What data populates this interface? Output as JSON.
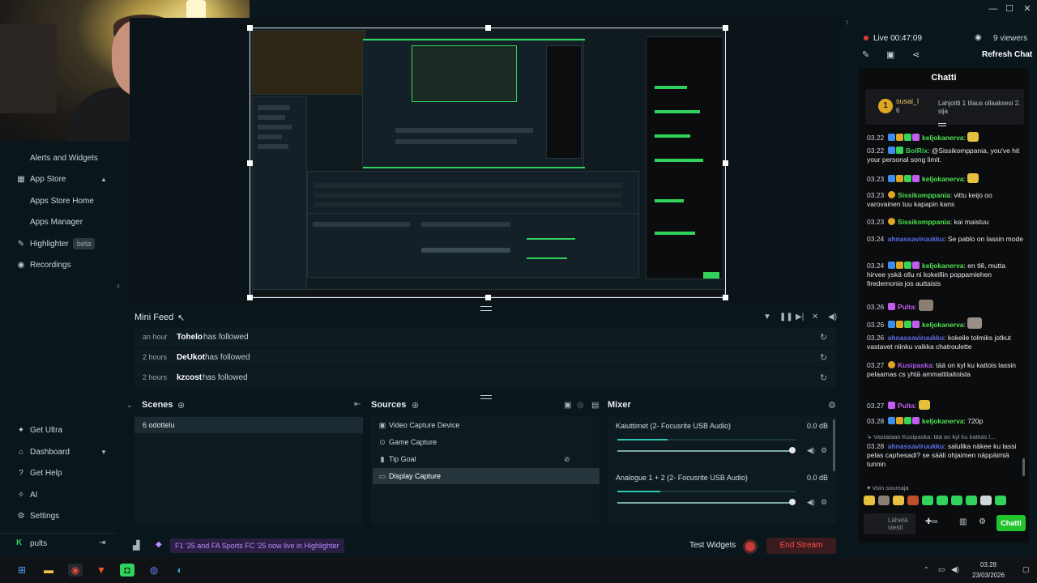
{
  "sidebar": {
    "items": [
      {
        "label": "Alerts and Widgets",
        "icon": "none"
      },
      {
        "label": "App Store",
        "icon": "store-icon"
      },
      {
        "label": "Apps Store Home",
        "icon": "none"
      },
      {
        "label": "Apps Manager",
        "icon": "none"
      },
      {
        "label": "Highlighter",
        "icon": "highlighter-icon",
        "badge": "beta"
      },
      {
        "label": "Recordings",
        "icon": "recordings-icon"
      }
    ],
    "bottom_items": [
      {
        "label": "Get Ultra",
        "icon": "ultra-icon"
      },
      {
        "label": "Dashboard",
        "icon": "dashboard-icon"
      },
      {
        "label": "Get Help",
        "icon": "help-icon"
      },
      {
        "label": "AI",
        "icon": "ai-icon"
      },
      {
        "label": "Settings",
        "icon": "gear-icon"
      }
    ],
    "user": "pults"
  },
  "minifeed": {
    "title": "Mini Feed",
    "rows": [
      {
        "time": "an hour",
        "user": "Tohelo",
        "action": "has followed"
      },
      {
        "time": "2 hours",
        "user": "DeUkot",
        "action": "has followed"
      },
      {
        "time": "2 hours",
        "user": "kzcost",
        "action": "has followed"
      }
    ]
  },
  "scenes": {
    "title": "Scenes",
    "items": [
      "6 odottelu"
    ]
  },
  "sources": {
    "title": "Sources",
    "items": [
      {
        "label": "Video Capture Device",
        "icon": "camera-icon"
      },
      {
        "label": "Game Capture",
        "icon": "gamepad-icon"
      },
      {
        "label": "Tip Goal",
        "icon": "file-icon"
      },
      {
        "label": "Display Capture",
        "icon": "monitor-icon"
      }
    ],
    "selected_index": 3
  },
  "mixer": {
    "title": "Mixer",
    "channels": [
      {
        "name": "Kaiuttimet (2- Focusrite USB Audio)",
        "db": "0.0 dB",
        "level": 0.28,
        "volume": 1.0
      },
      {
        "name": "Analogue 1 + 2 (2- Focusrite USB Audio)",
        "db": "0.0 dB",
        "level": 0.24,
        "volume": 1.0
      }
    ]
  },
  "footer": {
    "promo": "F1 '25 and FA Sports FC '25 now live in Highlighter",
    "test_widgets": "Test Widgets",
    "end_stream": "End Stream"
  },
  "chat": {
    "live": "Live 00:47:09",
    "viewers": "9 viewers",
    "refresh": "Refresh Chat",
    "title": "Chatti",
    "pinned": {
      "name": "susai_l",
      "count": "6",
      "text": "Lahjoitti 1 tilaus ollaaksesi 2. sija"
    },
    "messages": [
      {
        "time": "03.22",
        "name": "keljokanerva",
        "color": "#4fe24f",
        "text": ""
      },
      {
        "time": "03.22",
        "name": "BolRix",
        "color": "#3ad35a",
        "text": "@Sissikomppania, you've hit your personal song limit."
      },
      {
        "time": "03.23",
        "name": "keljokanerva",
        "color": "#4fe24f",
        "text": ""
      },
      {
        "time": "03.23",
        "name": "Sissikomppania",
        "color": "#4fe24f",
        "text": "vittu keijo oo varovainen tuu kapapin kans"
      },
      {
        "time": "03.23",
        "name": "Sissikomppania",
        "color": "#4fe24f",
        "text": "kai maistuu"
      },
      {
        "time": "03.24",
        "name": "ahnassaviruukku",
        "color": "#5b6ee8",
        "text": "Se pablo on lassin mode"
      },
      {
        "time": "03.24",
        "name": "keljokanerva",
        "color": "#4fe24f",
        "text": "en tlê, mutta hirvee yskä ollu ni kokeillin poppamiehen firedemonia jos auttaisis"
      },
      {
        "time": "03.26",
        "name": "Pulta",
        "color": "#c45cf0",
        "text": ""
      },
      {
        "time": "03.26",
        "name": "keljokanerva",
        "color": "#4fe24f",
        "text": ""
      },
      {
        "time": "03.26",
        "name": "ahnassaviruukku",
        "color": "#5b6ee8",
        "text": "kokeile tolmiks jotkut vastavet niinku vaikka chatroulette"
      },
      {
        "time": "03.27",
        "name": "Kusipaska",
        "color": "#b15ce8",
        "text": "tää on kyl ku kattois lassin pelaamas cs yhtä ammattitaitoista"
      },
      {
        "time": "03.27",
        "name": "Pulta",
        "color": "#c45cf0",
        "text": ""
      },
      {
        "time": "03.28",
        "name": "keljokanerva",
        "color": "#4fe24f",
        "text": "720p"
      },
      {
        "time": "",
        "name": "",
        "color": "#9aa0a6",
        "text": "Vastataan Kusipaska: tää on kyl ku kattois l..."
      },
      {
        "time": "03.28",
        "name": "ahnassaviruukku",
        "color": "#5b6ee8",
        "text": "salulika näkee ku lassi pelas caphesadi? se sääli ohjaimen näppäimiä tunnin"
      }
    ],
    "reply_hint": "Voin soumaja",
    "input_placeholder": "Lähetä viesti",
    "send": "Chatti"
  },
  "taskbar": {
    "time": "03.28",
    "date": "23/03/2026"
  },
  "colors": {
    "accent": "#31d35c",
    "danger": "#ff4b4b",
    "promo": "#b88cff"
  }
}
